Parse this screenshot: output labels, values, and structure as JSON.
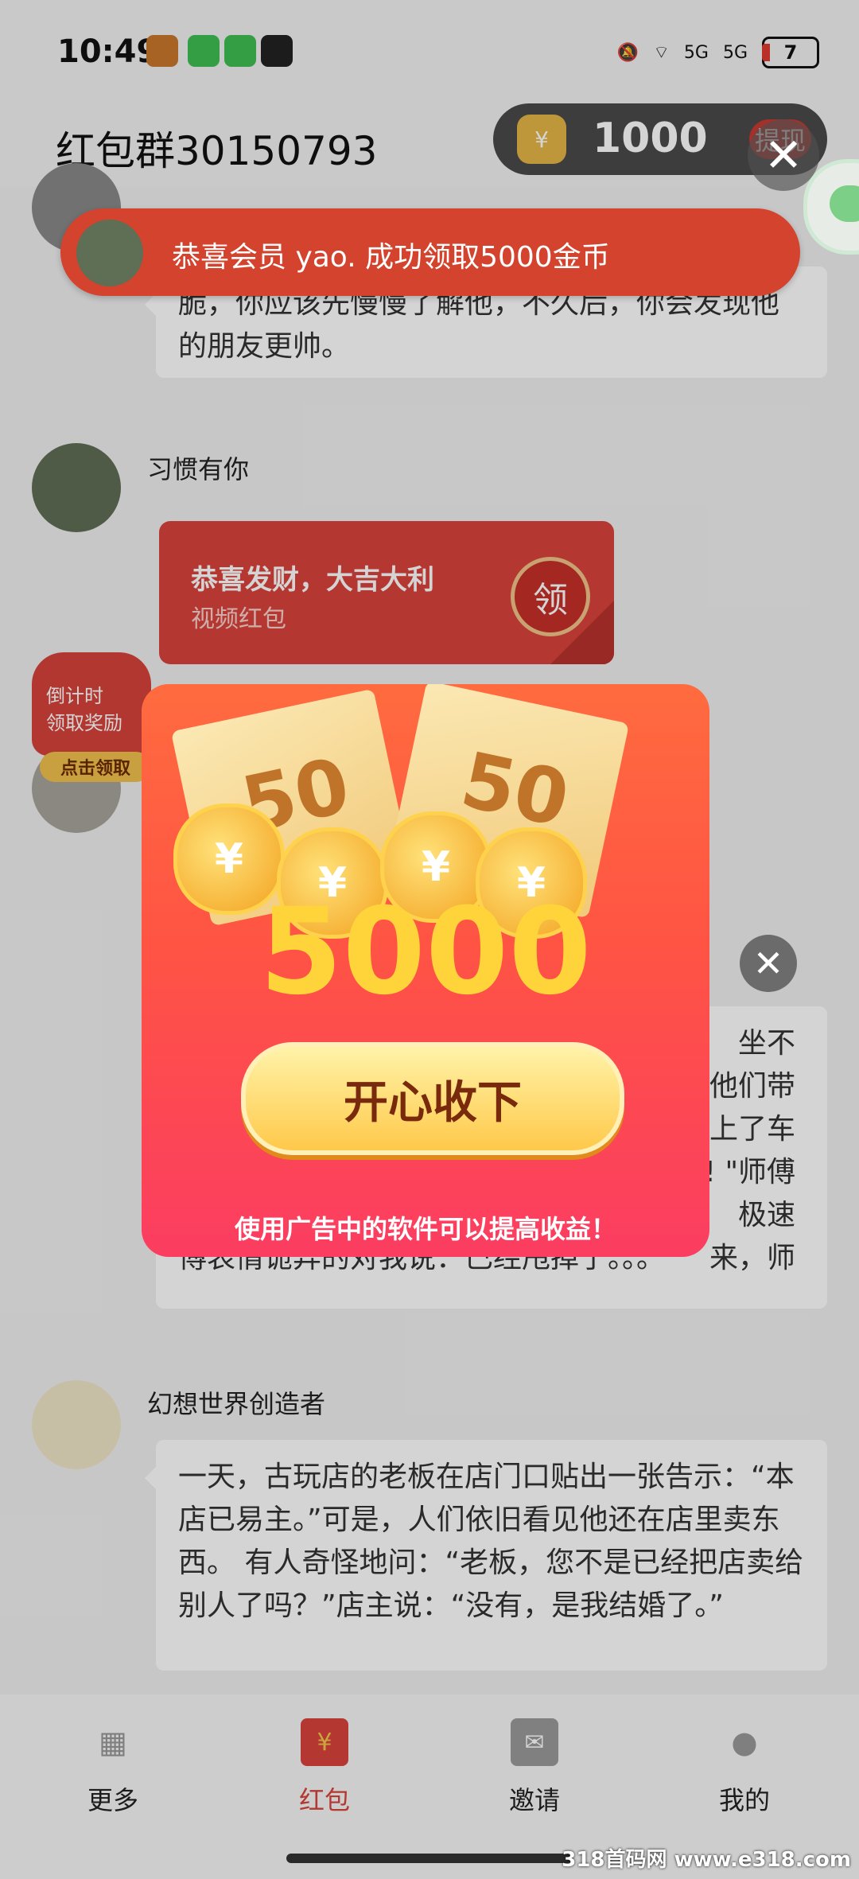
{
  "status_bar": {
    "time": "10:49",
    "signal_1": "5G",
    "signal_2": "5G",
    "battery": "7"
  },
  "header": {
    "group_title": "红包群30150793",
    "coin_amount": "1000",
    "withdraw_label": "提现"
  },
  "toast": {
    "text": "恭喜会员 yao. 成功领取5000金币"
  },
  "chat": {
    "messages": [
      {
        "nickname": "",
        "text": "脆，你应该先慢慢了解他，不久后，你会发现他的朋友更帅。"
      },
      {
        "nickname": "习惯有你",
        "red_packet_title": "恭喜发财，大吉大利",
        "red_packet_sub": "视频红包",
        "claim_label": "领"
      },
      {
        "nickname": "",
        "text_lines": [
          "坐不",
          "他们带",
          "上了车",
          "! \"师傅",
          "极速",
          "来，师",
          "傅表情诡异的对我说：已经甩掉了。。。"
        ]
      },
      {
        "nickname": "幻想世界创造者",
        "text": "一天，古玩店的老板在店门口贴出一张告示：“本店已易主。”可是，人们依旧看见他还在店里卖东西。 有人奇怪地问：“老板，您不是已经把店卖给别人了吗？”店主说：“没有，是我结婚了。”"
      }
    ]
  },
  "countdown_widget": {
    "line1": "倒计时",
    "line2": "领取奖励",
    "button": "点击领取"
  },
  "popup": {
    "ticket_value_1": "50",
    "ticket_value_2": "50",
    "coin_symbol": "¥",
    "amount": "5000",
    "collect_label": "开心收下",
    "note": "使用广告中的软件可以提高收益！"
  },
  "tabs": [
    {
      "label": "更多",
      "icon": "grid-icon",
      "active": false
    },
    {
      "label": "红包",
      "icon": "red-packet-icon",
      "active": true
    },
    {
      "label": "邀请",
      "icon": "invite-envelope-icon",
      "active": false
    },
    {
      "label": "我的",
      "icon": "profile-icon",
      "active": false
    }
  ],
  "watermark": "318首码网 www.e318.com",
  "colors": {
    "accent": "#d9443c",
    "tab_active": "#d9443c",
    "coin_gold": "#ffd43b"
  }
}
